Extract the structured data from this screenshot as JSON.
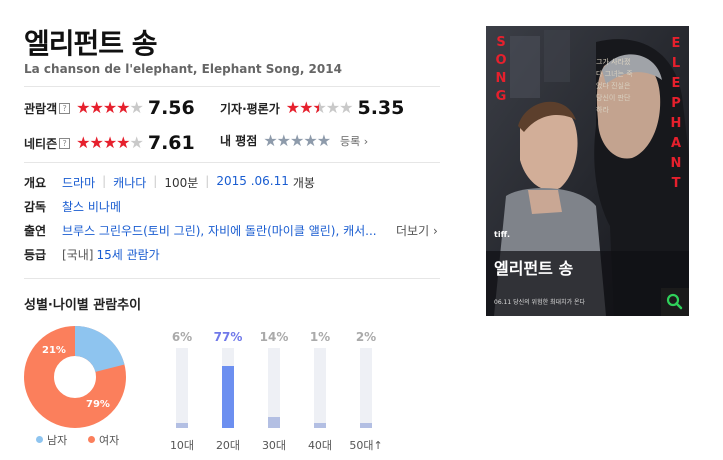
{
  "movie": {
    "title": "엘리펀트 송",
    "subtitle": "La chanson de l'elephant, Elephant Song, 2014"
  },
  "ratings": {
    "audience": {
      "label": "관람객",
      "help": "?",
      "score": "7.56",
      "stars": 4
    },
    "critics": {
      "label": "기자·평론가",
      "score": "5.35",
      "stars": 2.5
    },
    "netizen": {
      "label": "네티즌",
      "help": "?",
      "score": "7.61",
      "stars": 4
    },
    "mine": {
      "label": "내 평점",
      "register": "등록",
      "register_arrow": "›"
    }
  },
  "info": {
    "overview": {
      "label": "개요",
      "genre": "드라마",
      "country": "캐나다",
      "runtime": "100분",
      "release_date": "2015 .06.11",
      "release_label": "개봉"
    },
    "director": {
      "label": "감독",
      "name": "찰스 비나메"
    },
    "cast": {
      "label": "출연",
      "text": "브루스 그린우드(토비 그린), 자비에 돌란(마이클 앨린), 캐서...",
      "more": "더보기",
      "more_arrow": "›"
    },
    "grade": {
      "label": "등급",
      "prefix": "[국내]",
      "value": "15세 관람가"
    }
  },
  "audience_trend": {
    "title": "성별·나이별 관람추이",
    "gender": {
      "male": {
        "label": "남자",
        "pct": "21%",
        "value": 21,
        "color": "#8ec4ef"
      },
      "female": {
        "label": "여자",
        "pct": "79%",
        "value": 79,
        "color": "#fb7f5c"
      }
    },
    "ages": [
      {
        "label": "10대",
        "pct": "6%",
        "value": 6
      },
      {
        "label": "20대",
        "pct": "77%",
        "value": 77
      },
      {
        "label": "30대",
        "pct": "14%",
        "value": 14
      },
      {
        "label": "40대",
        "pct": "1%",
        "value": 1
      },
      {
        "label": "50대↑",
        "pct": "2%",
        "value": 2
      }
    ]
  },
  "poster": {
    "side_left": "SONG",
    "side_right": "ELEPHANT",
    "title": "엘리펀트 송",
    "badge": "tiff.",
    "zoom_icon": "search-icon",
    "release_line": "06.11 당신의 위험한 최대치가 온다",
    "tagline": "그가 사라졌다 그녀는 죽었다 진실은 당신이 판단하라"
  }
}
